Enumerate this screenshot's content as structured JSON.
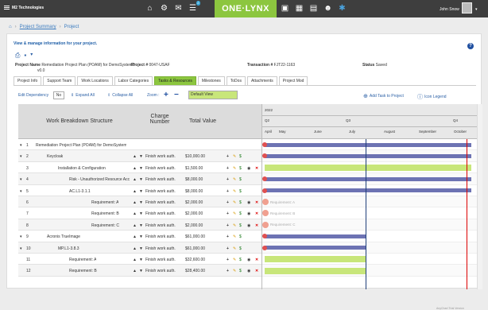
{
  "topbar": {
    "company": "M2 Technologies",
    "logo": "ONE·LYNX",
    "user": "John Snow",
    "badge": "2"
  },
  "breadcrumb": [
    "Project Summary",
    "Project"
  ],
  "page_title": "View & manage information for your project.",
  "project": {
    "name_label": "Project Name",
    "name_value": "Remediation Project Plan (POAM) for DemoSystem3",
    "version": "v0.0",
    "num_label": "Project #",
    "num_value": "0047-USAF",
    "trans_label": "Transaction #",
    "trans_value": "FJT22-1163",
    "status_label": "Status",
    "status_value": "Saved"
  },
  "tabs": [
    "Project Info",
    "Support Team",
    "Work Locations",
    "Labor Categories",
    "Tasks & Resources",
    "Milestones",
    "ToDos",
    "Attachments",
    "Project Mod"
  ],
  "toolbar": {
    "edit_dep": "Edit Dependency",
    "no": "No",
    "expand": "Expand All",
    "collapse": "Collapse All",
    "zoom": "Zoom :",
    "default_view": "Default View",
    "add_task": "Add Task to Project",
    "legend": "Icon Legend"
  },
  "grid_headers": {
    "wbs": "Work Breakdown Structure",
    "charge": "Charge Number",
    "total": "Total Value"
  },
  "rows": [
    {
      "n": "1",
      "name": "Remediation Project Plan (POAM) for DemoSystem",
      "fin": "",
      "val": ""
    },
    {
      "n": "2",
      "name": "Keycloak",
      "fin": "Finish work auth.",
      "val": "$10,000.00"
    },
    {
      "n": "3",
      "name": "Installation & Configuration",
      "fin": "Finish work auth.",
      "val": "$1,500.00"
    },
    {
      "n": "4",
      "name": "Risk - Unauthorized Resource Access",
      "fin": "Finish work auth.",
      "val": "$8,000.00"
    },
    {
      "n": "5",
      "name": "AC.L1-3.1.1",
      "fin": "Finish work auth.",
      "val": "$8,000.00"
    },
    {
      "n": "6",
      "name": "Requirement: A",
      "fin": "Finish work auth.",
      "val": "$2,000.00"
    },
    {
      "n": "7",
      "name": "Requirement: B",
      "fin": "Finish work auth.",
      "val": "$2,000.00"
    },
    {
      "n": "8",
      "name": "Requirement: C",
      "fin": "Finish work auth.",
      "val": "$2,000.00"
    },
    {
      "n": "9",
      "name": "Acronis TrueImage",
      "fin": "Finish work auth.",
      "val": "$61,000.00"
    },
    {
      "n": "10",
      "name": "MP.L1-3.8.3",
      "fin": "Finish work auth.",
      "val": "$61,000.00"
    },
    {
      "n": "11",
      "name": "Requirement: A",
      "fin": "Finish work auth.",
      "val": "$32,600.00"
    },
    {
      "n": "12",
      "name": "Requirement: B",
      "fin": "Finish work auth.",
      "val": "$28,400.00"
    }
  ],
  "gantt": {
    "year": "2022",
    "quarters": [
      "Q2",
      "Q3",
      "Q4"
    ],
    "months": [
      "April",
      "May",
      "June",
      "July",
      "August",
      "September",
      "October"
    ],
    "bar_labels": [
      "Requirement: A",
      "Requirement: B",
      "Requirement: C"
    ]
  },
  "credit": "AnyChart Trial Version"
}
